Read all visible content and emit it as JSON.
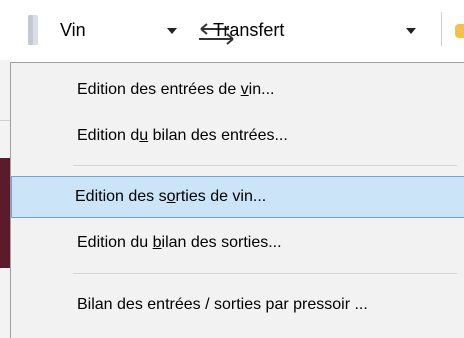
{
  "toolbar": {
    "wine_dropdown": {
      "label": "Vin",
      "icon": "wine-bottle-icon"
    },
    "transfer_dropdown": {
      "label": "Transfert",
      "icon": "transfer-arrows-icon"
    }
  },
  "menu": {
    "items": [
      {
        "before": "Edition des entrées de ",
        "accel": "v",
        "after": "in..."
      },
      {
        "before": "Edition d",
        "accel": "u",
        "after": " bilan des entrées..."
      },
      {
        "before": "Edition des s",
        "accel": "o",
        "after": "rties de vin...",
        "selected": true
      },
      {
        "before": "Edition du ",
        "accel": "b",
        "after": "ilan des sorties..."
      },
      {
        "before": "Bilan des entrées / sorties par pressoir ...",
        "accel": "",
        "after": ""
      }
    ]
  },
  "colors": {
    "selection_bg": "#cce4f7",
    "selection_border": "#6aa8dc",
    "menu_bg": "#f2f2f2"
  }
}
